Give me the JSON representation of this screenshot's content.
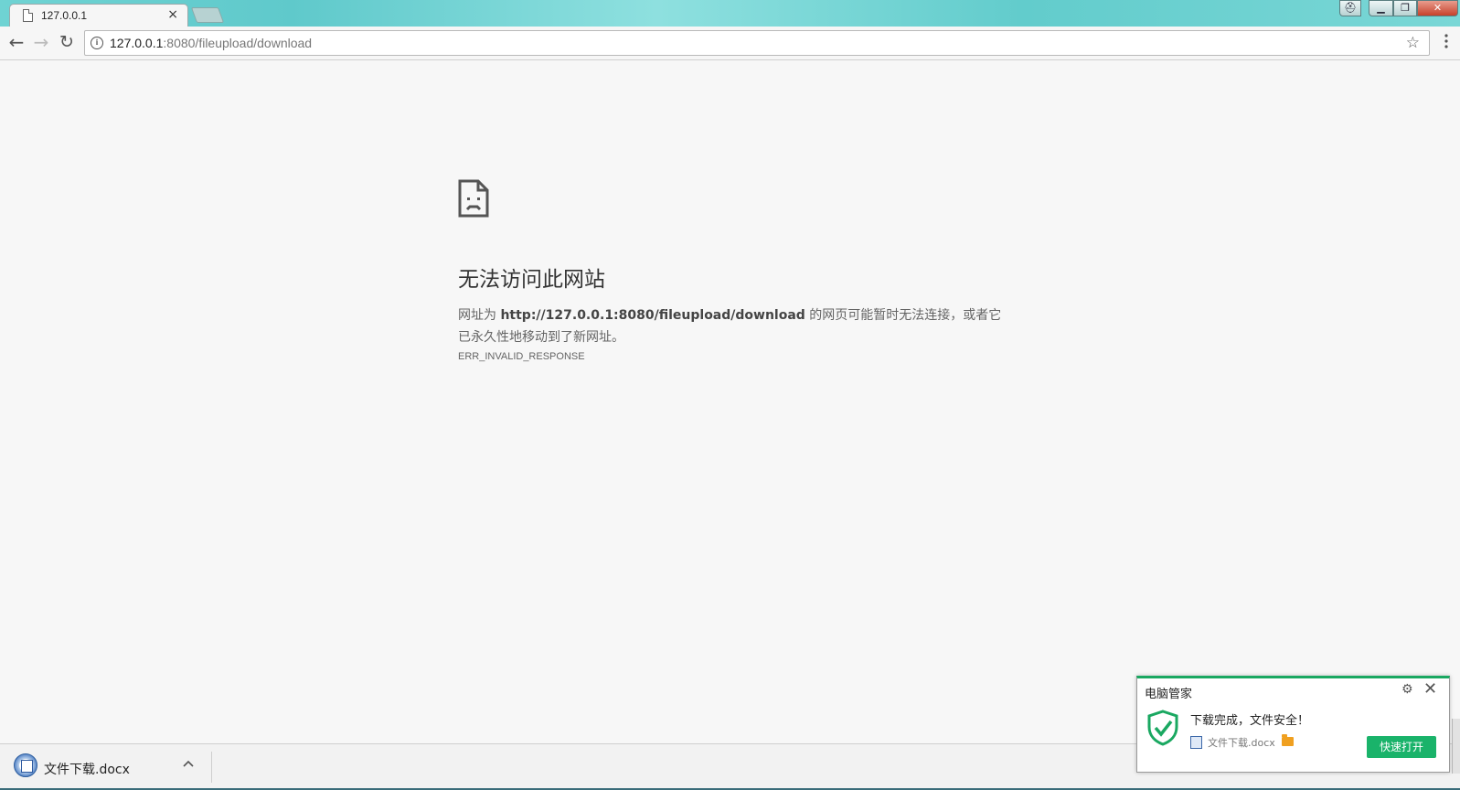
{
  "tab": {
    "title": "127.0.0.1",
    "close": "×"
  },
  "window_buttons": {
    "user": "⛑",
    "min": "▁",
    "max": "❐",
    "close": "✕"
  },
  "toolbar": {
    "back": "←",
    "forward": "→",
    "reload": "↻",
    "url_host": "127.0.0.1",
    "url_rest": ":8080/fileupload/download",
    "star": "☆",
    "menu": "⋮"
  },
  "error": {
    "title": "无法访问此网站",
    "msg_prefix": "网址为 ",
    "msg_url": "http://127.0.0.1:8080/fileupload/download",
    "msg_suffix": " 的网页可能暂时无法连接，或者它已永久性地移动到了新网址。",
    "code": "ERR_INVALID_RESPONSE"
  },
  "download_shelf": {
    "file_name": "文件下载.docx",
    "chevron": "^"
  },
  "popup": {
    "title": "电脑管家",
    "gear": "⚙",
    "close": "✕",
    "message": "下载完成，文件安全！",
    "file_name": "文件下载.docx",
    "open_button": "快速打开",
    "accent_color": "#1ab36a"
  }
}
